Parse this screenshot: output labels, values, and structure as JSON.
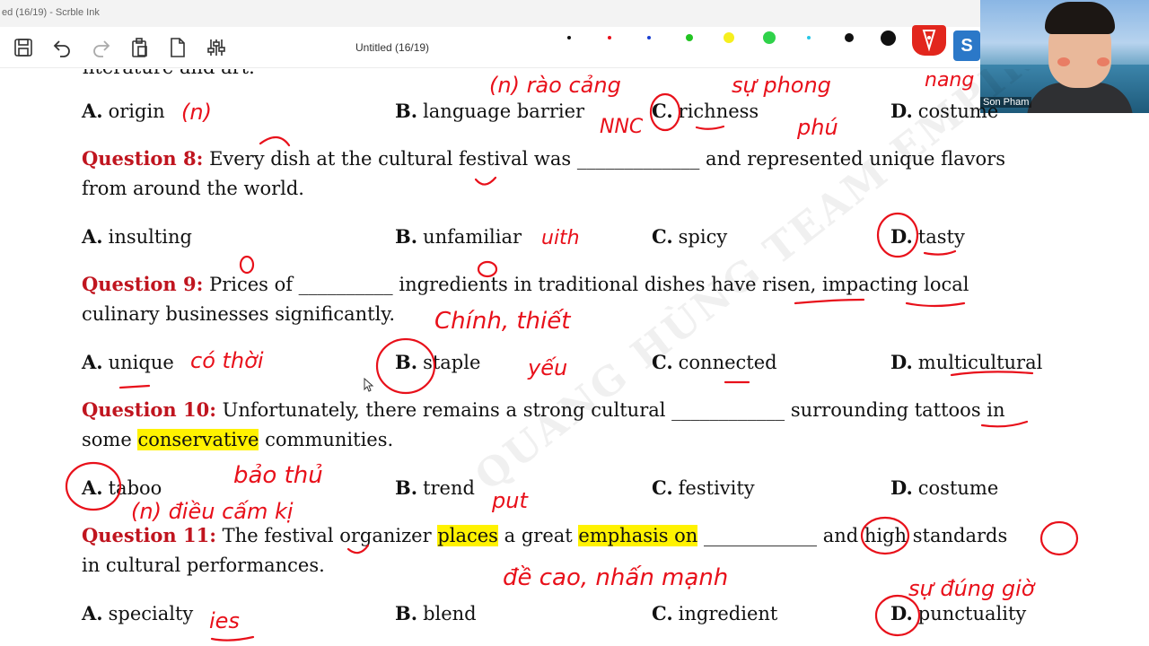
{
  "app": {
    "window_title": "ed (16/19) - Scrble Ink",
    "document_title": "Untitled (16/19)"
  },
  "colors": {
    "question_red": "#c0151f",
    "ink_red": "#e8101a",
    "highlight": "#fff200",
    "pen_button": "#e2261d",
    "badge_blue": "#2b78c8"
  },
  "toolbar": {
    "icons": [
      "save-icon",
      "undo-icon",
      "redo-icon",
      "paste-icon",
      "new-page-icon",
      "settings-sliders-icon"
    ],
    "badge_letter": "S"
  },
  "webcam": {
    "name": "Son Pham"
  },
  "partial_line": "literature and art.",
  "questions": [
    {
      "num": "Question 8:",
      "line1": "Every dish at the cultural festival was _____________ and represented unique flavors",
      "line2": "from around the world.",
      "options": [
        {
          "letter": "A.",
          "text": "insulting"
        },
        {
          "letter": "B.",
          "text": "unfamiliar"
        },
        {
          "letter": "C.",
          "text": "spicy"
        },
        {
          "letter": "D.",
          "text": "tasty"
        }
      ]
    },
    {
      "num": "Question 9:",
      "line1": "Prices of __________ ingredients in traditional dishes have risen, impacting local",
      "line2": "culinary businesses significantly.",
      "options": [
        {
          "letter": "A.",
          "text": "unique"
        },
        {
          "letter": "B.",
          "text": "staple"
        },
        {
          "letter": "C.",
          "text": "connected"
        },
        {
          "letter": "D.",
          "text": "multicultural"
        }
      ]
    },
    {
      "num": "Question 10:",
      "line1": "Unfortunately, there remains a strong cultural ____________ surrounding tattoos in",
      "line2_a": "some ",
      "line2_hl": "conservative",
      "line2_b": " communities.",
      "options": [
        {
          "letter": "A.",
          "text": "taboo"
        },
        {
          "letter": "B.",
          "text": "trend"
        },
        {
          "letter": "C.",
          "text": "festivity"
        },
        {
          "letter": "D.",
          "text": "costume"
        }
      ]
    },
    {
      "num": "Question 11:",
      "line1_a": "The festival organizer ",
      "line1_hl1": "places",
      "line1_b": " a great ",
      "line1_hl2": "emphasis on",
      "line1_c": " ____________ and high standards",
      "line2": "in cultural performances.",
      "options": [
        {
          "letter": "A.",
          "text": "specialty"
        },
        {
          "letter": "B.",
          "text": "blend"
        },
        {
          "letter": "C.",
          "text": "ingredient"
        },
        {
          "letter": "D.",
          "text": "punctuality"
        }
      ]
    }
  ],
  "q7_options": [
    {
      "letter": "A.",
      "text": "origin"
    },
    {
      "letter": "B.",
      "text": "language barrier"
    },
    {
      "letter": "C.",
      "text": "richness"
    },
    {
      "letter": "D.",
      "text": "costume"
    }
  ],
  "handwriting": {
    "n1": "(n)",
    "rao_cang": "(n) rào cảng",
    "nnc": "NNC",
    "su_phong_phu": "sự phong",
    "phu": "phú",
    "nang": "nang",
    "uith": "uith",
    "chinh_thiet_yeu": "Chính, thiết",
    "yeu": "yếu",
    "co_thoi": "có thời",
    "bao_thu": "bảo thủ",
    "dieu_cam_ky": "(n) điều cấm kị",
    "put": "put",
    "de_cao": "đề cao, nhấn mạnh",
    "su_dung_gio": "sự đúng giờ",
    "ies": "ies"
  },
  "watermark": "QUANG HÙNG TEAM EMPIRE"
}
